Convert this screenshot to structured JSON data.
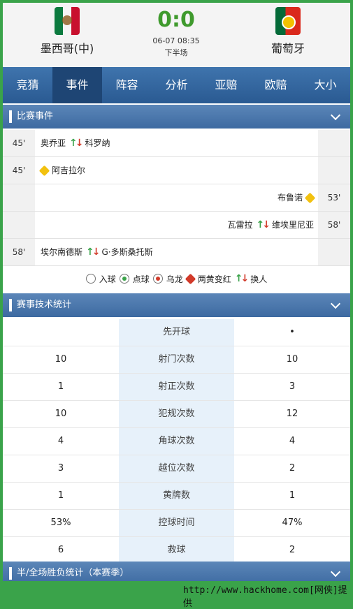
{
  "header": {
    "home_team": "墨西哥(中)",
    "away_team": "葡萄牙",
    "score": "0:0",
    "date": "06-07 08:35",
    "status": "下半场"
  },
  "tabs": [
    "竞猜",
    "事件",
    "阵容",
    "分析",
    "亚赔",
    "欧赔",
    "大小"
  ],
  "events_section": {
    "title": "比赛事件"
  },
  "events": [
    {
      "side": "home",
      "minute": "45'",
      "type": "substitution",
      "player_in": "奥乔亚",
      "player_out": "科罗纳"
    },
    {
      "side": "home",
      "minute": "45'",
      "type": "yellow-card",
      "player": "阿吉拉尔"
    },
    {
      "side": "away",
      "minute": "53'",
      "type": "yellow-card",
      "player": "布鲁诺"
    },
    {
      "side": "away",
      "minute": "58'",
      "type": "substitution",
      "player_in": "瓦雷拉",
      "player_out": "维埃里尼亚"
    },
    {
      "side": "home",
      "minute": "58'",
      "type": "substitution",
      "player_in": "埃尔南德斯",
      "player_out": "G·多斯桑托斯"
    }
  ],
  "legend": {
    "goal": "入球",
    "penalty": "点球",
    "own_goal": "乌龙",
    "two_yellow_red": "两黄变红",
    "substitution": "换人"
  },
  "stats_section": {
    "title": "赛事技术统计"
  },
  "stats": [
    {
      "home": "",
      "label": "先开球",
      "away": "•"
    },
    {
      "home": "10",
      "label": "射门次数",
      "away": "10"
    },
    {
      "home": "1",
      "label": "射正次数",
      "away": "3"
    },
    {
      "home": "10",
      "label": "犯规次数",
      "away": "12"
    },
    {
      "home": "4",
      "label": "角球次数",
      "away": "4"
    },
    {
      "home": "3",
      "label": "越位次数",
      "away": "2"
    },
    {
      "home": "1",
      "label": "黄牌数",
      "away": "1"
    },
    {
      "home": "53%",
      "label": "控球时间",
      "away": "47%"
    },
    {
      "home": "6",
      "label": "救球",
      "away": "2"
    }
  ],
  "season_section": {
    "title": "半/全场胜负统计（本赛季）"
  },
  "watermark": "http://www.hackhome.com[网侠]提供"
}
